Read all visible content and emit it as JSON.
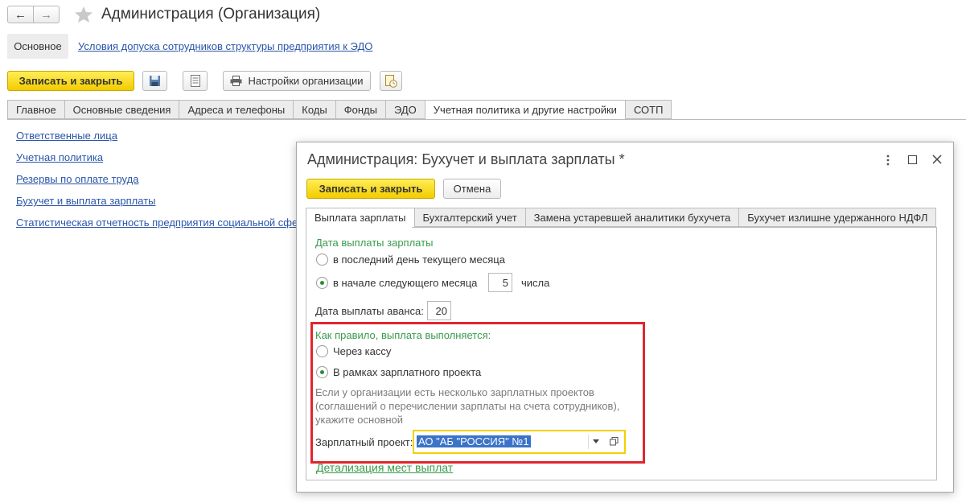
{
  "window": {
    "title": "Администрация (Организация)",
    "back_glyph": "←",
    "forward_glyph": "→",
    "favorite_icon": "star-icon"
  },
  "top_nav": {
    "main_label": "Основное",
    "link_label": "Условия допуска сотрудников структуры предприятия к ЭДО"
  },
  "toolbar": {
    "save_close_label": "Записать и закрыть",
    "org_settings_label": "Настройки организации"
  },
  "tabs": [
    {
      "label": "Главное",
      "active": false
    },
    {
      "label": "Основные сведения",
      "active": false
    },
    {
      "label": "Адреса и телефоны",
      "active": false
    },
    {
      "label": "Коды",
      "active": false
    },
    {
      "label": "Фонды",
      "active": false
    },
    {
      "label": "ЭДО",
      "active": false
    },
    {
      "label": "Учетная политика и другие настройки",
      "active": true
    },
    {
      "label": "СОТП",
      "active": false
    }
  ],
  "left_links": [
    "Ответственные лица",
    "Учетная политика",
    "Резервы по оплате труда",
    "Бухучет и выплата зарплаты",
    "Статистическая отчетность предприятия социальной сфер"
  ],
  "dialog": {
    "title": "Администрация: Бухучет и выплата зарплаты *",
    "save_close_label": "Записать и закрыть",
    "cancel_label": "Отмена",
    "tabs": [
      {
        "label": "Выплата зарплаты",
        "active": true
      },
      {
        "label": "Бухгалтерский учет",
        "active": false
      },
      {
        "label": "Замена устаревшей аналитики бухучета",
        "active": false
      },
      {
        "label": "Бухучет излишне удержанного НДФЛ",
        "active": false
      }
    ],
    "salary_date": {
      "heading": "Дата выплаты зарплаты",
      "option_last_day": "в последний день текущего месяца",
      "option_next_month": "в начале следующего месяца",
      "day_value": "5",
      "day_suffix": "числа",
      "selected": "next_month"
    },
    "advance": {
      "label": "Дата выплаты аванса:",
      "value": "20"
    },
    "payment_method": {
      "heading": "Как правило, выплата выполняется:",
      "option_cash": "Через кассу",
      "option_project": "В рамках зарплатного проекта",
      "selected": "project",
      "hint_line1": "Если у организации есть несколько зарплатных проектов",
      "hint_line2": "(соглашений о перечислении зарплаты на счета сотрудников),",
      "hint_line3": "укажите основной",
      "project_label": "Зарплатный проект:",
      "project_value": "АО \"АБ \"РОССИЯ\" №1"
    },
    "details_link": "Детализация мест выплат"
  },
  "colors": {
    "accent_yellow": "#f5d000",
    "highlight_red": "#e0262e",
    "link_blue": "#2a55a8",
    "heading_green": "#3a9b4b",
    "selection_blue": "#3b73c8"
  }
}
